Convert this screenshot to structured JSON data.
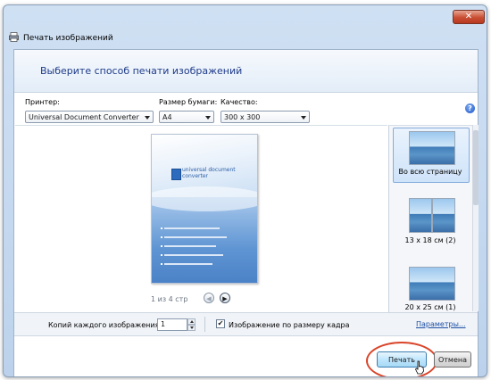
{
  "window": {
    "title": "Печать изображений",
    "close_label": "✕"
  },
  "header": {
    "instruction": "Выберите способ печати изображений"
  },
  "printer": {
    "label": "Принтер:",
    "value": "Universal Document Converter"
  },
  "paper": {
    "label": "Размер бумаги:",
    "value": "A4"
  },
  "quality": {
    "label": "Качество:",
    "value": "300 x 300"
  },
  "help": {
    "icon": "help-icon",
    "glyph": "?"
  },
  "preview": {
    "page": {
      "brand_line1": "universal document",
      "brand_line2": "converter"
    },
    "pager": {
      "text": "1 из 4 стр",
      "prev": "◀",
      "next": "▶"
    }
  },
  "layouts": [
    {
      "label": "Во всю страницу",
      "selected": true
    },
    {
      "label": "13 x 18 см (2)",
      "selected": false
    },
    {
      "label": "20 x 25 см (1)",
      "selected": false
    }
  ],
  "options": {
    "copies_label": "Копий каждого изображения:",
    "copies_value": "1",
    "fit_checked_glyph": "✔",
    "fit_label": "Изображение по размеру кадра",
    "params_link": "Параметры..."
  },
  "buttons": {
    "print": "Печать",
    "cancel": "Отмена"
  },
  "colors": {
    "accent_link": "#1e4fa6",
    "highlight": "#d9462b",
    "header_text": "#1e3b8a"
  }
}
